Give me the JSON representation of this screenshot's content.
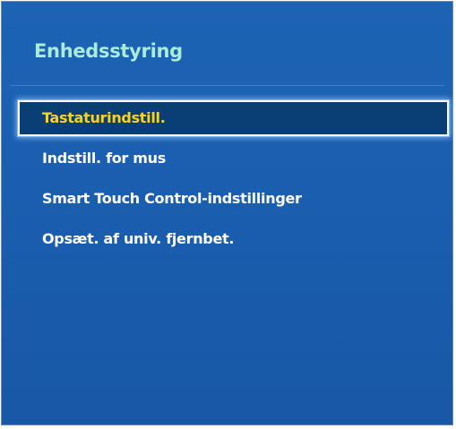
{
  "panel": {
    "title": "Enhedsstyring"
  },
  "menu": {
    "items": [
      {
        "label": "Tastaturindstill.",
        "selected": true
      },
      {
        "label": "Indstill. for mus",
        "selected": false
      },
      {
        "label": "Smart Touch Control-indstillinger",
        "selected": false
      },
      {
        "label": "Opsæt. af univ. fjernbet.",
        "selected": false
      }
    ]
  },
  "colors": {
    "panel_background": "#1a5eaf",
    "title_text": "#a9ecd8",
    "item_text": "#ffffff",
    "selected_text": "#ffd21a",
    "selected_background": "#0a3f75",
    "selected_border": "#ffffff"
  }
}
